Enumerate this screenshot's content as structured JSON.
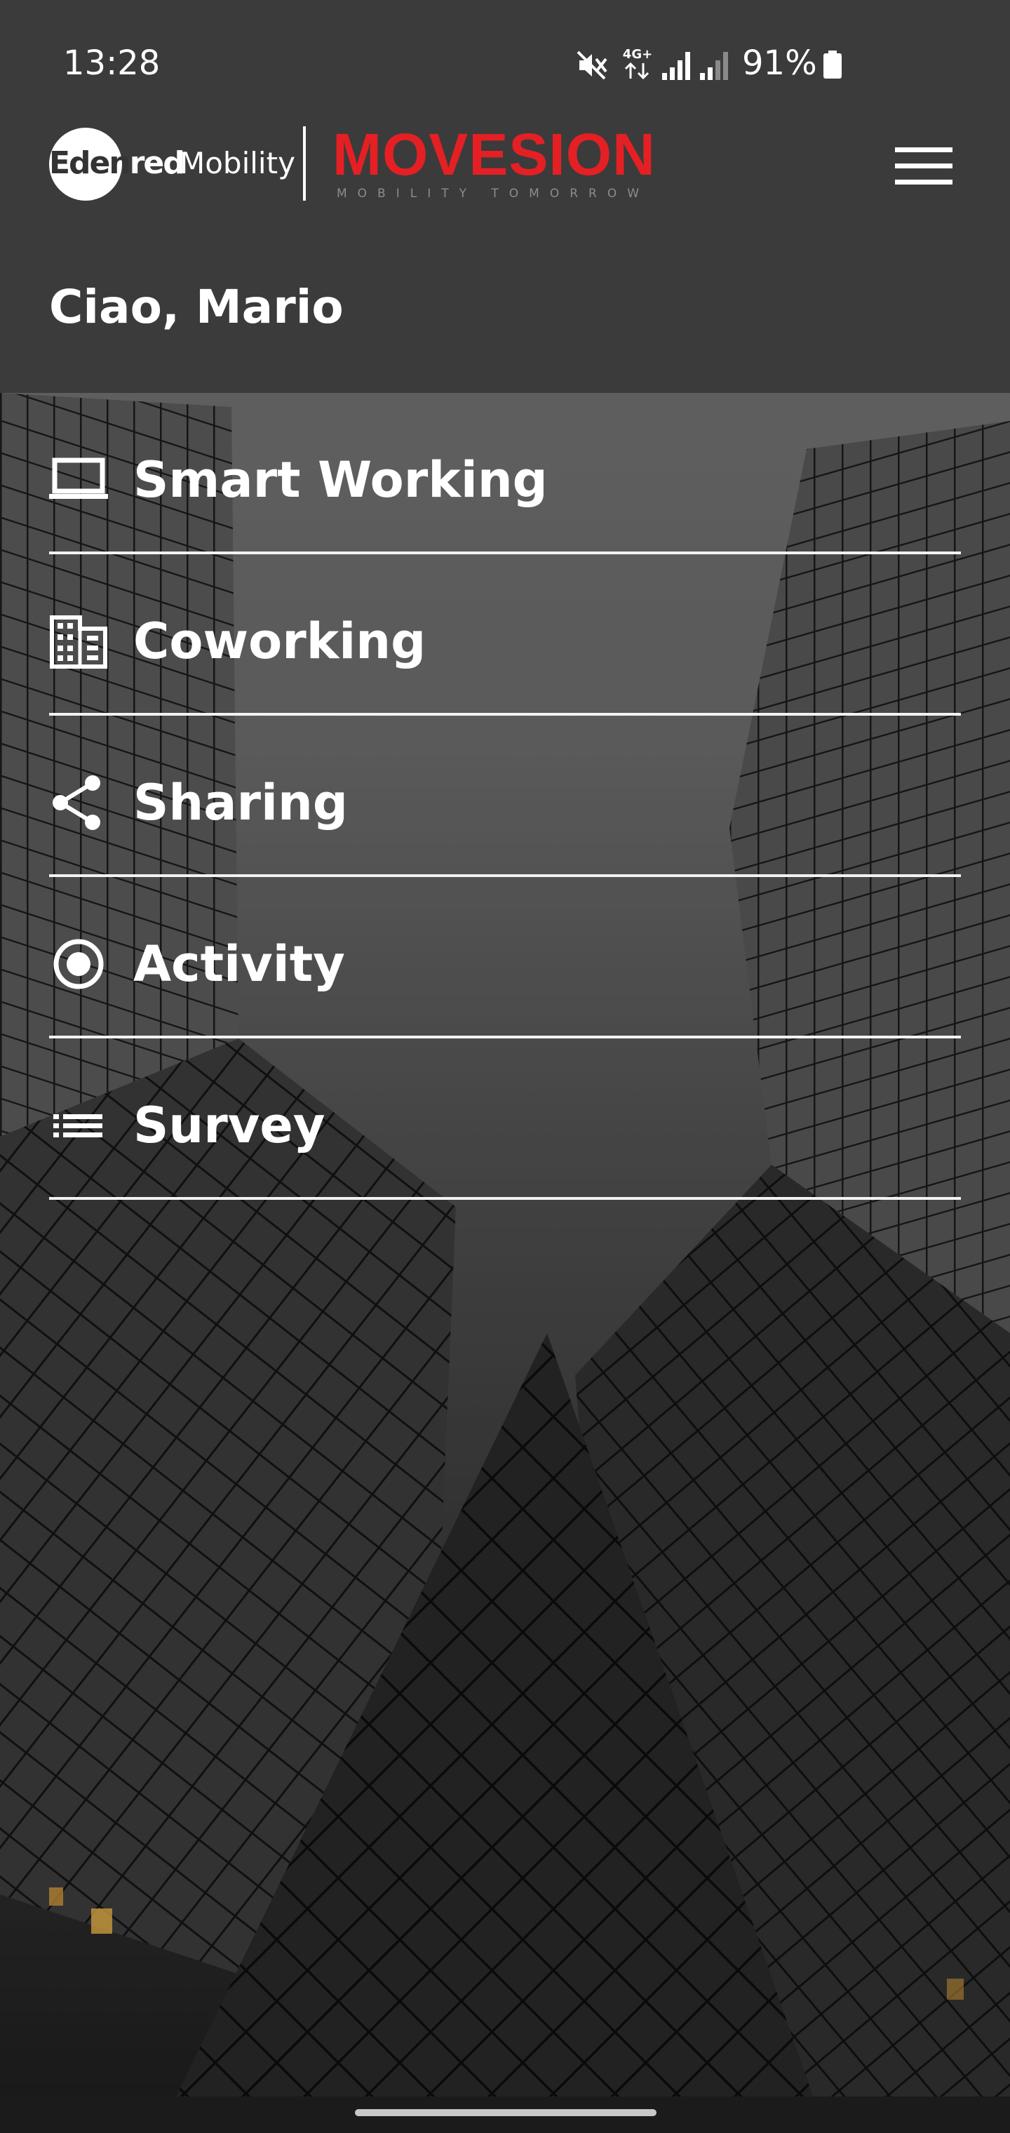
{
  "status_bar": {
    "time": "13:28",
    "battery": "91%",
    "network_label": "4G+",
    "icons": [
      "mute-icon",
      "network-4g-icon",
      "signal-icon",
      "signal-weak-icon",
      "battery-icon"
    ]
  },
  "brand": {
    "edenred_dark": "Eden",
    "edenred_light": "red",
    "mobility": "Mobility",
    "movesion": "MOVESION",
    "tagline": "MOBILITY TOMORROW",
    "accent_color": "#e42024"
  },
  "header": {
    "greeting": "Ciao, Mario",
    "menu_icon": "hamburger-menu-icon"
  },
  "nav": {
    "items": [
      {
        "label": "Smart Working",
        "icon": "laptop-icon"
      },
      {
        "label": "Coworking",
        "icon": "building-icon"
      },
      {
        "label": "Sharing",
        "icon": "share-icon"
      },
      {
        "label": "Activity",
        "icon": "radio-target-icon"
      },
      {
        "label": "Survey",
        "icon": "list-icon"
      }
    ]
  }
}
